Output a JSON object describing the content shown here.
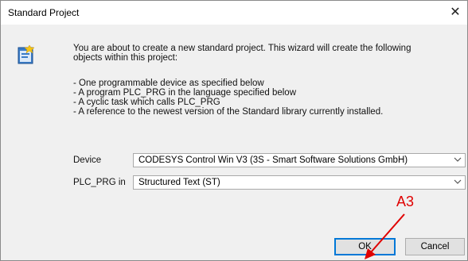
{
  "window": {
    "title": "Standard Project"
  },
  "intro": {
    "line1": "You are about to create a new standard project. This wizard will create the following",
    "line2": "objects within this project:"
  },
  "bullets": [
    "- One programmable device as specified below",
    "- A program PLC_PRG in the language specified below",
    "- A cyclic task which calls PLC_PRG",
    "- A reference to the newest version of the Standard library currently installed."
  ],
  "form": {
    "device_label": "Device",
    "device_value": "CODESYS Control Win V3 (3S - Smart Software Solutions GmbH)",
    "plc_label": "PLC_PRG in",
    "plc_value": "Structured Text (ST)"
  },
  "buttons": {
    "ok": "OK",
    "cancel": "Cancel"
  },
  "annotation": {
    "label": "A3",
    "color": "#e00000"
  },
  "icons": {
    "close": "close-icon",
    "wizard": "project-wizard-icon",
    "dropdown": "chevron-down-icon"
  }
}
